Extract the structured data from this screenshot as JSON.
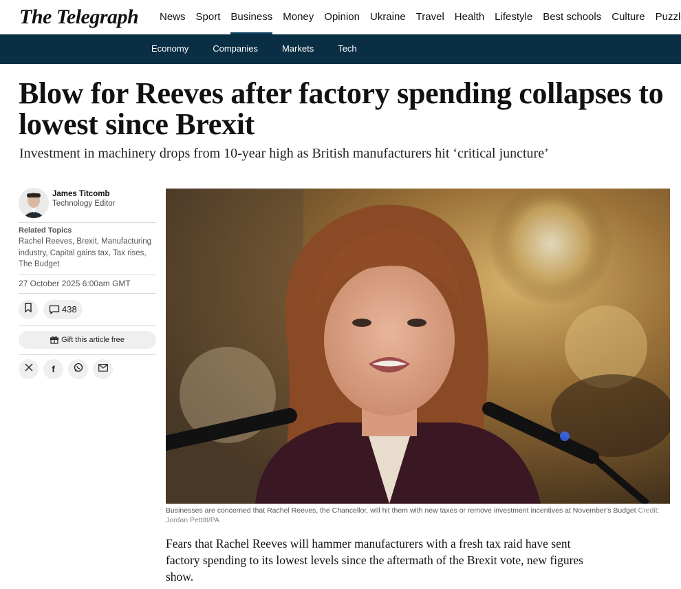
{
  "site": {
    "logo": "The Telegraph"
  },
  "nav": {
    "items": [
      {
        "label": "News"
      },
      {
        "label": "Sport"
      },
      {
        "label": "Business",
        "active": true
      },
      {
        "label": "Money"
      },
      {
        "label": "Opinion"
      },
      {
        "label": "Ukraine"
      },
      {
        "label": "Travel"
      },
      {
        "label": "Health"
      },
      {
        "label": "Lifestyle"
      },
      {
        "label": "Best schools"
      },
      {
        "label": "Culture"
      },
      {
        "label": "Puzzles"
      }
    ]
  },
  "subnav": {
    "items": [
      {
        "label": "Economy"
      },
      {
        "label": "Companies"
      },
      {
        "label": "Markets"
      },
      {
        "label": "Tech"
      }
    ]
  },
  "article": {
    "headline": "Blow for Reeves after factory spending collapses to lowest since Brexit",
    "standfirst": "Investment in machinery drops from 10-year high as British manufacturers hit ‘critical juncture’",
    "author": {
      "name": "James Titcomb",
      "role": "Technology Editor"
    },
    "related": {
      "title": "Related Topics",
      "topics": "Rachel Reeves, Brexit, Manufacturing industry, Capital gains tax, Tax rises, The Budget"
    },
    "date": "27 October 2025 6:00am GMT",
    "comment_count": "438",
    "gift_label": "Gift this article free",
    "share_icons": [
      "x-icon",
      "facebook-icon",
      "whatsapp-icon",
      "email-icon"
    ],
    "image": {
      "caption": "Businesses are concerned that Rachel Reeves, the Chancellor, will hit them with new taxes or remove investment incentives at November's Budget",
      "credit": "Credit: Jordan Pettitt/PA"
    },
    "body_first_paragraph": "Fears that Rachel Reeves will hammer manufacturers with a fresh tax raid have sent factory spending to its lowest levels since the aftermath of the Brexit vote, new figures show."
  },
  "colors": {
    "subnav_bg": "#0a2e44",
    "active_underline": "#0b3d5a"
  }
}
